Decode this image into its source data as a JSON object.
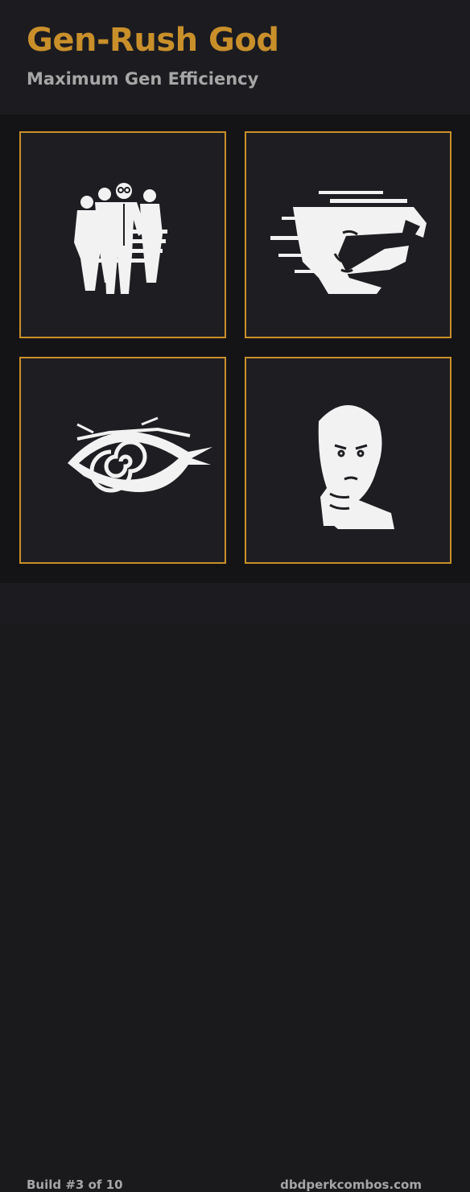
{
  "header": {
    "title": "Gen-Rush God",
    "subtitle": "Maximum Gen Efficiency"
  },
  "perks": [
    {
      "icon": "team-survivors-icon"
    },
    {
      "icon": "hair-face-icon"
    },
    {
      "icon": "spiral-eye-icon"
    },
    {
      "icon": "worried-woman-icon"
    }
  ],
  "footer": {
    "build_label": "Build #3 of 10",
    "site": "dbdperkcombos.com"
  },
  "colors": {
    "accent": "#c98f2a",
    "background": "#1a1a1d",
    "card": "#1e1e22",
    "muted_text": "#a6a6a6"
  }
}
